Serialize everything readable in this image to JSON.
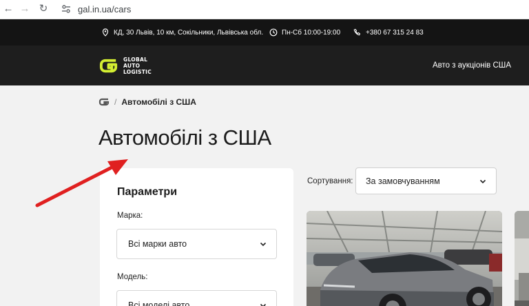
{
  "browser": {
    "url": "gal.in.ua/cars",
    "back_icon": "←",
    "forward_icon": "→",
    "reload_icon": "↻"
  },
  "info_bar": {
    "address": "КД, 30 Львів, 10 км, Сокільники, Львівська обл.",
    "hours": "Пн-Сб 10:00-19:00",
    "phone": "+380 67 315 24 83"
  },
  "header": {
    "logo_line1": "GLOBAL",
    "logo_line2": "AUTO",
    "logo_line3": "LOGISTIC",
    "nav_link": "Авто з аукціонів США",
    "accent_color": "#d4ef32"
  },
  "breadcrumb": {
    "separator": "/",
    "current": "Автомобілі з США"
  },
  "page": {
    "title": "Автомобілі з США"
  },
  "filters": {
    "heading": "Параметри",
    "make_label": "Марка:",
    "make_value": "Всі марки авто",
    "model_label": "Модель:",
    "model_value": "Всі моделі авто"
  },
  "sorting": {
    "label": "Сортування:",
    "value": "За замовчуванням"
  },
  "icons": {
    "address": "location-pin-icon",
    "hours": "clock-icon",
    "phone": "phone-icon",
    "chevron": "chevron-down-icon"
  }
}
